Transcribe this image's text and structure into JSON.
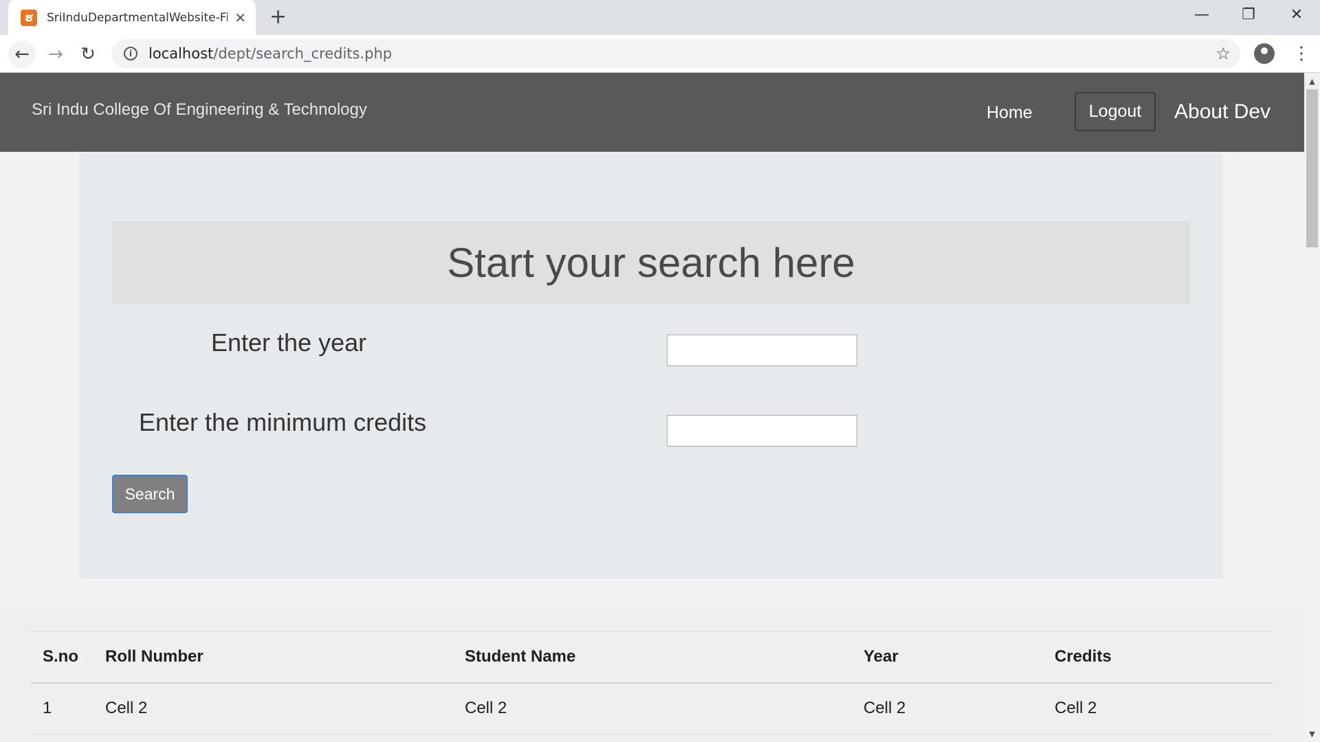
{
  "browser": {
    "tab_title": "SriInduDepartmentalWebsite-Final",
    "tab_favicon": "xampp-icon",
    "url_host": "localhost",
    "url_path": "/dept/search_credits.php"
  },
  "navbar": {
    "brand": "Sri Indu College Of Engineering & Technology",
    "home": "Home",
    "logout": "Logout",
    "about": "About Dev"
  },
  "search": {
    "heading": "Start your search here",
    "year_label": "Enter the year",
    "year_value": "",
    "credits_label": "Enter the minimum credits",
    "credits_value": "",
    "button": "Search"
  },
  "table": {
    "headers": [
      "S.no",
      "Roll Number",
      "Student Name",
      "Year",
      "Credits"
    ],
    "rows": [
      [
        "1",
        "Cell 2",
        "Cell 2",
        "Cell 2",
        "Cell 2"
      ]
    ]
  }
}
